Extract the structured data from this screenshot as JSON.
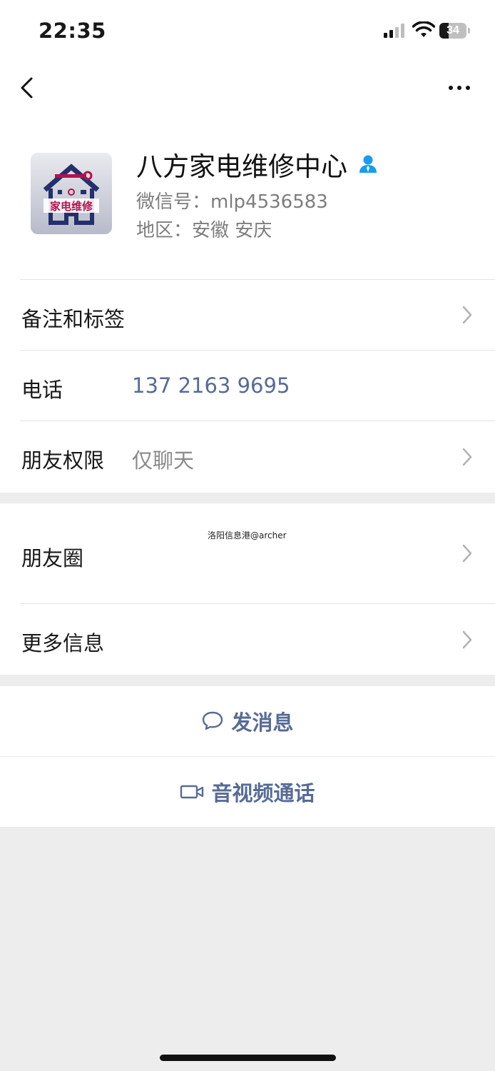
{
  "status_bar": {
    "time": "22:35",
    "battery": "34",
    "battery_level": 0.34
  },
  "profile": {
    "name": "八方家电维修中心",
    "wechat_id": "微信号：mlp4536583",
    "region": "地区：安徽 安庆",
    "avatar_text": "家电维修"
  },
  "rows": {
    "notes_label": "备注和标签",
    "phone_label": "电话",
    "phone_value": "137 2163 9695",
    "permission_label": "朋友权限",
    "permission_value": "仅聊天",
    "moments_label": "朋友圈",
    "more_label": "更多信息"
  },
  "watermark": "洛阳信息港@archer",
  "actions": {
    "message": "发消息",
    "call": "音视频通话"
  },
  "colors": {
    "link": "#576b95",
    "background": "#ededed",
    "verify": "#1a9bef"
  }
}
